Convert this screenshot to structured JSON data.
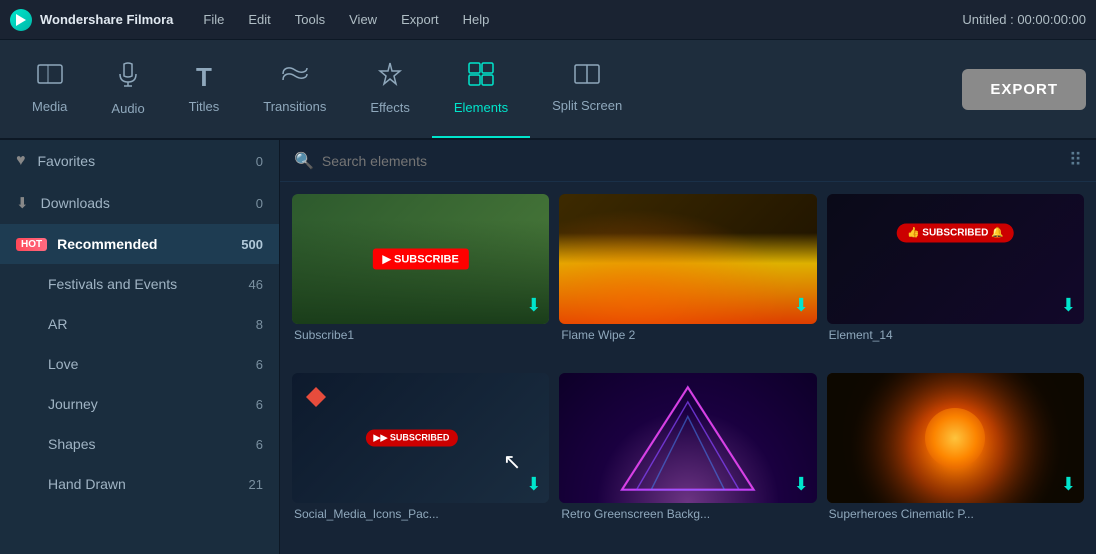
{
  "app": {
    "name": "Wondershare Filmora",
    "title": "Untitled : 00:00:00:00"
  },
  "menu": {
    "items": [
      "File",
      "Edit",
      "Tools",
      "View",
      "Export",
      "Help"
    ]
  },
  "toolbar": {
    "items": [
      {
        "id": "media",
        "label": "Media",
        "icon": "□"
      },
      {
        "id": "audio",
        "label": "Audio",
        "icon": "♩"
      },
      {
        "id": "titles",
        "label": "Titles",
        "icon": "T"
      },
      {
        "id": "transitions",
        "label": "Transitions",
        "icon": "⇄"
      },
      {
        "id": "effects",
        "label": "Effects",
        "icon": "✦"
      },
      {
        "id": "elements",
        "label": "Elements",
        "icon": "❋",
        "active": true
      },
      {
        "id": "split-screen",
        "label": "Split Screen",
        "icon": "▦"
      }
    ],
    "export_label": "EXPORT"
  },
  "sidebar": {
    "items": [
      {
        "id": "favorites",
        "label": "Favorites",
        "count": "0",
        "icon": "♥",
        "hot": false
      },
      {
        "id": "downloads",
        "label": "Downloads",
        "count": "0",
        "icon": "",
        "hot": false
      },
      {
        "id": "recommended",
        "label": "Recommended",
        "count": "500",
        "icon": "",
        "hot": true
      },
      {
        "id": "festivals",
        "label": "Festivals and Events",
        "count": "46",
        "icon": "",
        "hot": false
      },
      {
        "id": "ar",
        "label": "AR",
        "count": "8",
        "icon": "",
        "hot": false
      },
      {
        "id": "love",
        "label": "Love",
        "count": "6",
        "icon": "",
        "hot": false
      },
      {
        "id": "journey",
        "label": "Journey",
        "count": "6",
        "icon": "",
        "hot": false
      },
      {
        "id": "shapes",
        "label": "Shapes",
        "count": "6",
        "icon": "",
        "hot": false
      },
      {
        "id": "hand-drawn",
        "label": "Hand Drawn",
        "count": "21",
        "icon": "",
        "hot": false
      }
    ]
  },
  "search": {
    "placeholder": "Search elements"
  },
  "elements": {
    "items": [
      {
        "id": "subscribe1",
        "label": "Subscribe1",
        "type": "subscribe"
      },
      {
        "id": "flame-wipe-2",
        "label": "Flame Wipe 2",
        "type": "flame"
      },
      {
        "id": "element-14",
        "label": "Element_14",
        "type": "element14"
      },
      {
        "id": "social-media",
        "label": "Social_Media_Icons_Pac...",
        "type": "social"
      },
      {
        "id": "retro-greenscreen",
        "label": "Retro Greenscreen Backg...",
        "type": "retro"
      },
      {
        "id": "superheroes",
        "label": "Superheroes Cinematic P...",
        "type": "superheroes"
      }
    ]
  }
}
